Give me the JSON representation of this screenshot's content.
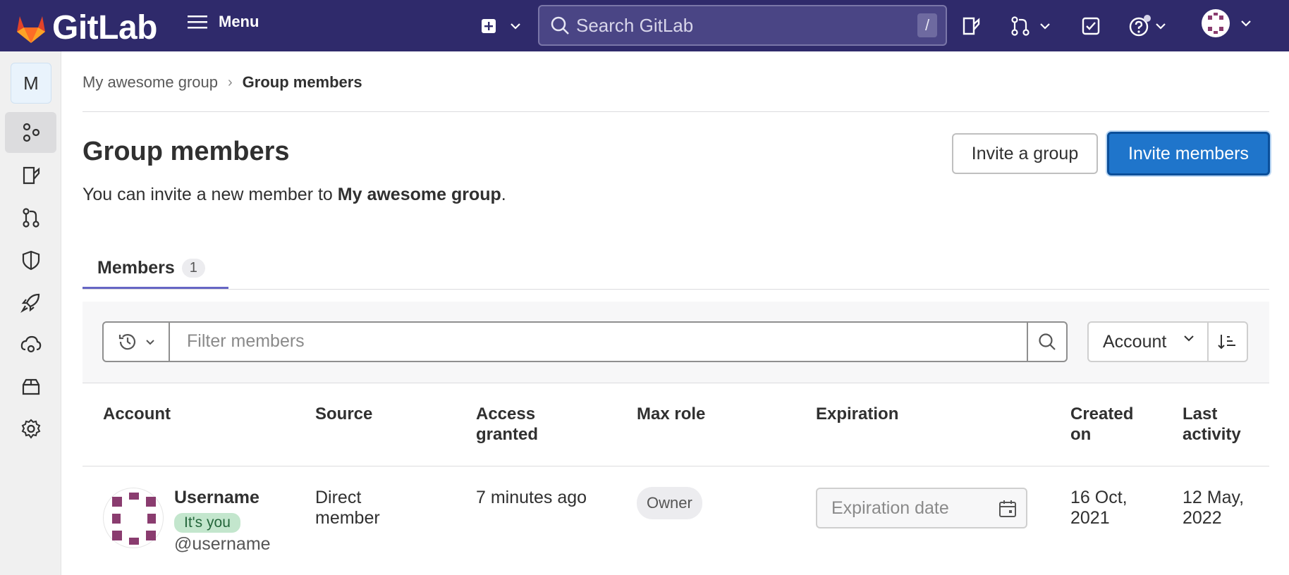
{
  "topbar": {
    "brand": "GitLab",
    "menu_label": "Menu",
    "search_placeholder": "Search GitLab",
    "search_shortcut": "/"
  },
  "sidebar": {
    "group_initial": "M",
    "items": [
      "group-overview-icon",
      "issues-icon",
      "merge-requests-icon",
      "security-icon",
      "deployments-icon",
      "monitor-icon",
      "packages-icon",
      "settings-icon"
    ]
  },
  "breadcrumb": {
    "parent": "My awesome group",
    "current": "Group members"
  },
  "page": {
    "title": "Group members",
    "subtitle_prefix": "You can invite a new member to ",
    "subtitle_group": "My awesome group",
    "subtitle_suffix": ".",
    "invite_group_label": "Invite a group",
    "invite_members_label": "Invite members"
  },
  "tabs": [
    {
      "label": "Members",
      "count": "1"
    }
  ],
  "filter": {
    "placeholder": "Filter members",
    "sort_label": "Account"
  },
  "table": {
    "headers": {
      "account": "Account",
      "source": "Source",
      "access_granted_1": "Access",
      "access_granted_2": "granted",
      "max_role": "Max role",
      "expiration": "Expiration",
      "created_on_1": "Created",
      "created_on_2": "on",
      "last_activity_1": "Last",
      "last_activity_2": "activity"
    },
    "rows": [
      {
        "name": "Username",
        "badge": "It's you",
        "handle": "@username",
        "source_1": "Direct",
        "source_2": "member",
        "access_granted": "7 minutes ago",
        "max_role": "Owner",
        "expiration_placeholder": "Expiration date",
        "created_1": "16 Oct,",
        "created_2": "2021",
        "last_activity_1": "12 May,",
        "last_activity_2": "2022"
      }
    ]
  },
  "colors": {
    "topbar": "#2f2a6b",
    "primary": "#1f75cb",
    "tab_underline": "#6666c4"
  }
}
